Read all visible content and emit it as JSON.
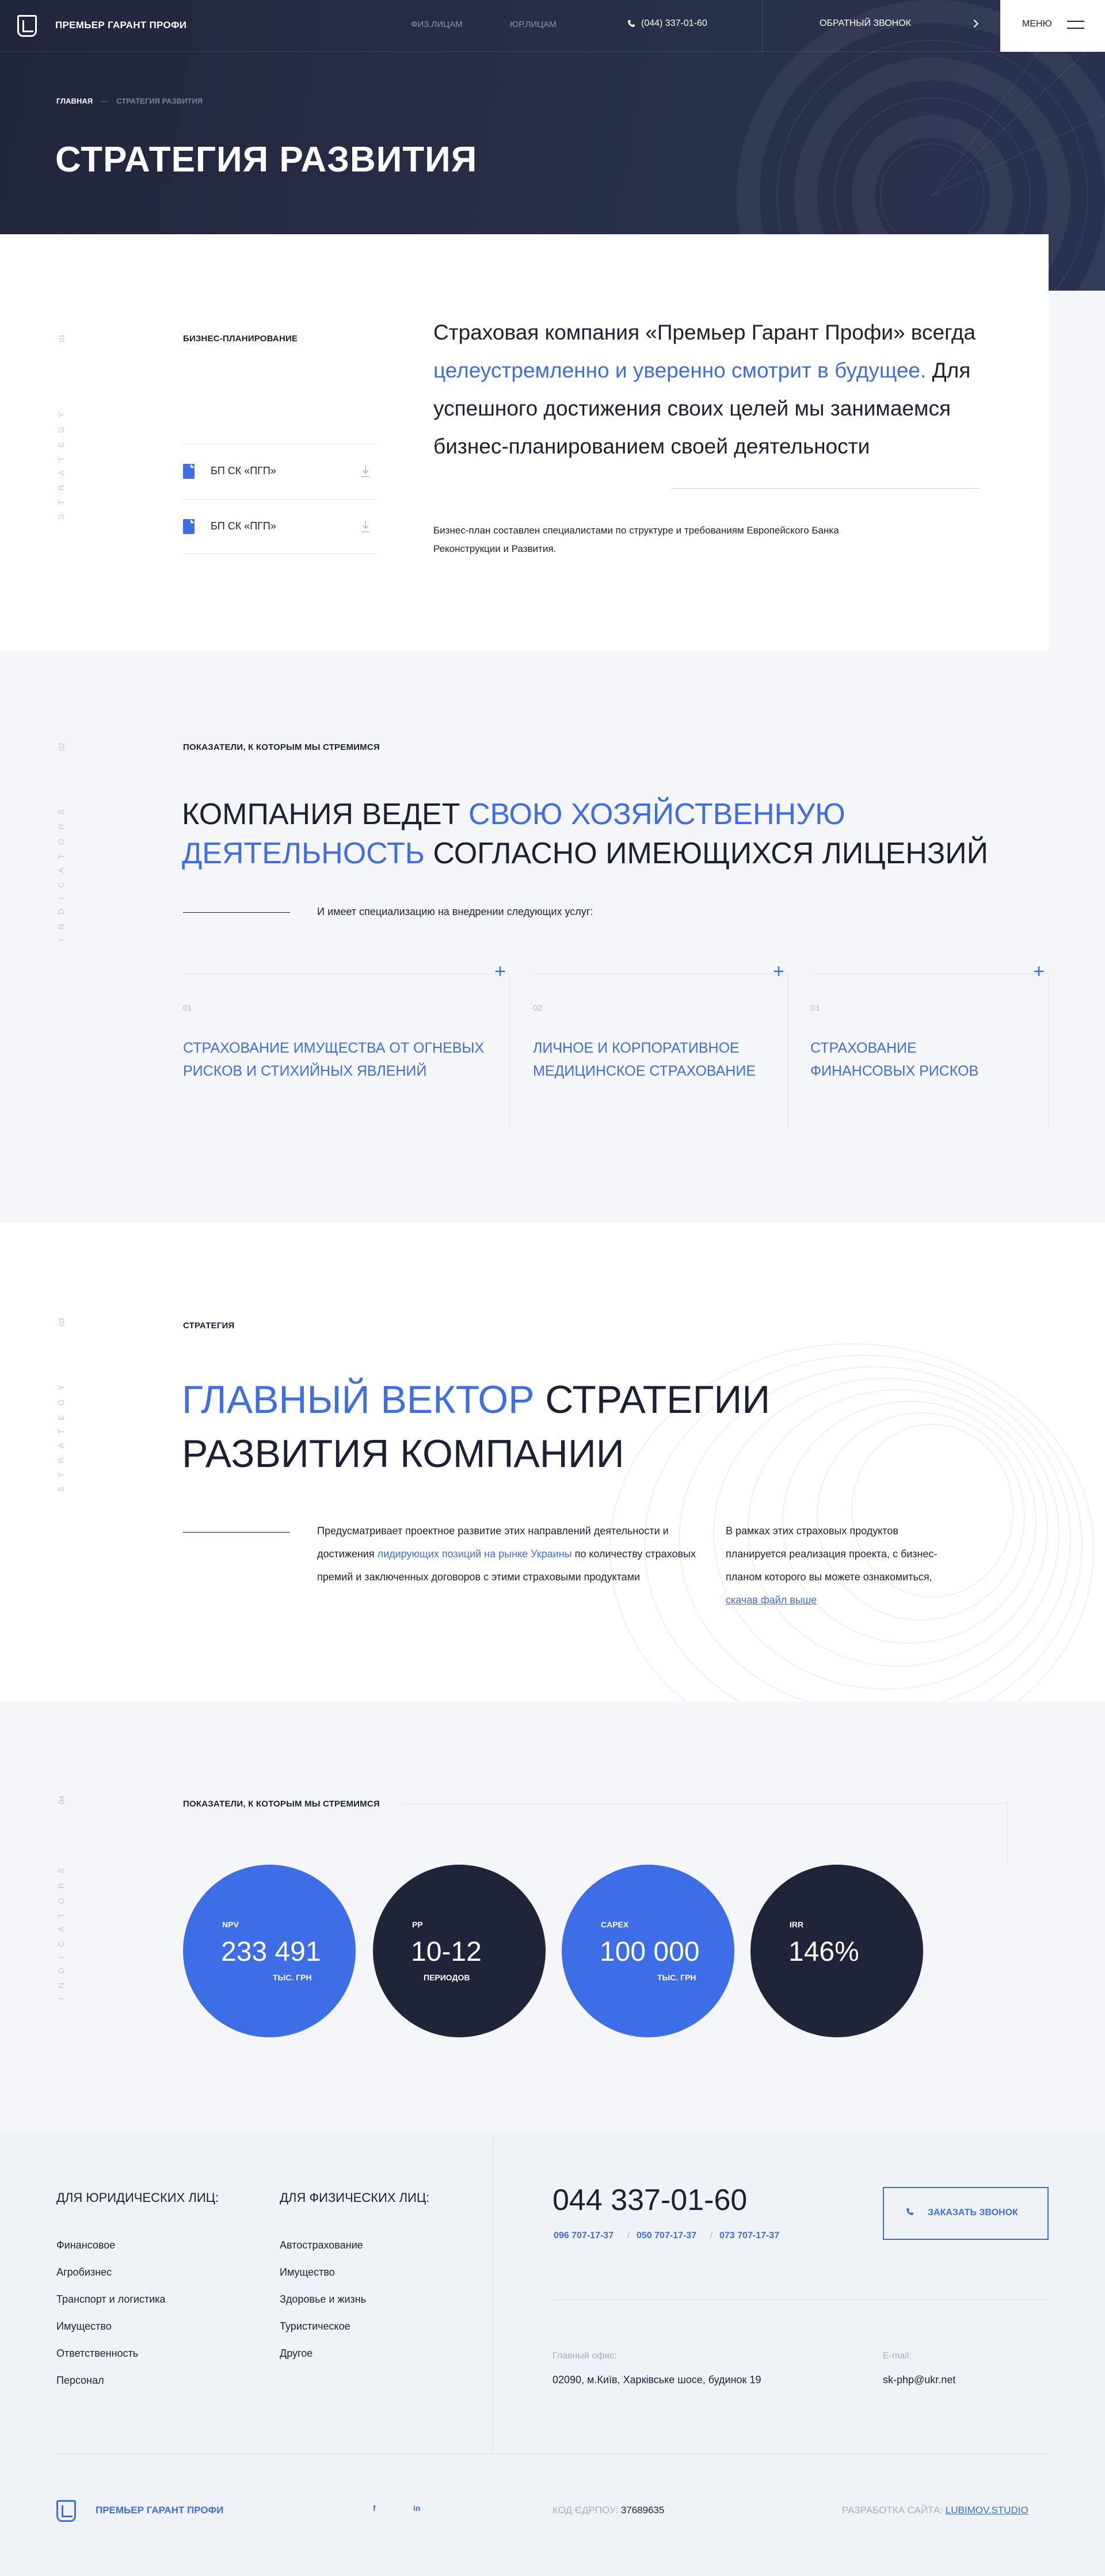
{
  "header": {
    "brand": "ПРЕМЬЕР ГАРАНТ ПРОФИ",
    "nav": [
      "ФИЗ.ЛИЦАМ",
      "ЮР.ЛИЦАМ"
    ],
    "phone": "(044) 337-01-60",
    "callback": "ОБРАТНЫЙ ЗВОНОК",
    "menu": "МЕНЮ"
  },
  "hero": {
    "breadcrumb_home": "ГЛАВНАЯ",
    "breadcrumb_sep": "—",
    "breadcrumb_current": "СТРАТЕГИЯ РАЗВИТИЯ",
    "title": "СТРАТЕГИЯ РАЗВИТИЯ"
  },
  "section1": {
    "index": "01",
    "side_word": "STRATEGY",
    "label": "БИЗНЕС-ПЛАНИРОВАНИЕ",
    "docs": [
      "БП СК «ПГП»",
      "БП СК «ПГП»"
    ],
    "intro_part1": "Страховая компания «Премьер Гарант Профи» всегда ",
    "intro_highlight": "целеустремленно и уверенно смотрит в будущее.",
    "intro_part2": " Для успешного достижения своих целей мы занимаемся бизнес-планированием своей деятельности",
    "note": "Бизнес-план составлен специалистами по структуре и требованиям Европейского Банка Реконструкции и Развития."
  },
  "section2": {
    "index": "02",
    "side_word": "INDICATORS",
    "label": "ПОКАЗАТЕЛИ, К КОТОРЫМ МЫ СТРЕМИМСЯ",
    "heading_p1": "КОМПАНИЯ ВЕДЕТ ",
    "heading_hl": "СВОЮ ХОЗЯЙСТВЕННУЮ ДЕЯТЕЛЬНОСТЬ",
    "heading_p2": " СОГЛАСНО ИМЕЮЩИХСЯ ЛИЦЕНЗИЙ",
    "lead": "И имеет специализацию на внедрении следующих услуг:",
    "services": [
      {
        "num": "01",
        "title": "СТРАХОВАНИЕ ИМУЩЕСТВА ОТ ОГНЕВЫХ РИСКОВ И СТИХИЙНЫХ ЯВЛЕНИЙ"
      },
      {
        "num": "02",
        "title": "ЛИЧНОЕ И КОРПОРАТИВНОЕ МЕДИЦИНСКОЕ СТРАХОВАНИЕ"
      },
      {
        "num": "03",
        "title": "СТРАХОВАНИЕ ФИНАНСОВЫХ РИСКОВ"
      }
    ],
    "plus": "+"
  },
  "section3": {
    "index": "03",
    "side_word": "STRATEGY",
    "label": "СТРАТЕГИЯ",
    "heading_hl": "ГЛАВНЫЙ ВЕКТОР",
    "heading_p1": " СТРАТЕГИИ",
    "heading_p2": "РАЗВИТИЯ КОМПАНИИ",
    "col1_p1": "Предусматривает проектное развитие этих направлений деятельности и достижения ",
    "col1_hl": "лидирующих позиций на рынке Украины",
    "col1_p2": " по количеству страховых премий и заключенных договоров с этими страховыми продуктами",
    "col2_p1": "В рамках этих страховых продуктов планируется реализация проекта, с бизнес-планом которого вы можете ознакомиться, ",
    "col2_link": "скачав файл выше"
  },
  "section4": {
    "index": "04",
    "side_word": "INDICATORS",
    "label": "ПОКАЗАТЕЛИ, К КОТОРЫМ МЫ СТРЕМИМСЯ",
    "metrics": [
      {
        "label": "NPV",
        "value": "233 491",
        "unit": "ТЫС. ГРН",
        "color": "#3d6ee8"
      },
      {
        "label": "PP",
        "value": "10-12",
        "unit": "ПЕРИОДОВ",
        "color": "#1f2438"
      },
      {
        "label": "CAPEX",
        "value": "100 000",
        "unit": "ТЫС. ГРН",
        "color": "#3d6ee8"
      },
      {
        "label": "IRR",
        "value": "146%",
        "unit": "",
        "color": "#1f2438"
      }
    ]
  },
  "footer": {
    "legal_title": "ДЛЯ ЮРИДИЧЕСКИХ ЛИЦ:",
    "legal_items": [
      "Финансовое",
      "Агробизнес",
      "Транспорт и логистика",
      "Имущество",
      "Ответственность",
      "Персонал"
    ],
    "phys_title": "ДЛЯ ФИЗИЧЕСКИХ ЛИЦ:",
    "phys_items": [
      "Автострахование",
      "Имущество",
      "Здоровье и жизнь",
      "Туристическое",
      "Другое"
    ],
    "phone": "044 337-01-60",
    "phones_extra": [
      "096 707-17-37",
      "050 707-17-37",
      "073 707-17-37"
    ],
    "phone_sep": "/",
    "order_call": "ЗАКАЗАТЬ ЗВОНОК",
    "office_caption": "Главный офис:",
    "office_address": "02090, м.Київ, Харківське шосе, будинок 19",
    "email_caption": "E-mail:",
    "email": "sk-php@ukr.net",
    "brand": "ПРЕМЬЕР ГАРАНТ ПРОФИ",
    "social": [
      "f",
      "in"
    ],
    "edrpou_caption": "КОД ЄДРПОУ:",
    "edrpou": "37689635",
    "dev_caption": "РАЗРАБОТКА САЙТА:",
    "dev_link": "LUBIMOV.STUDIO"
  }
}
